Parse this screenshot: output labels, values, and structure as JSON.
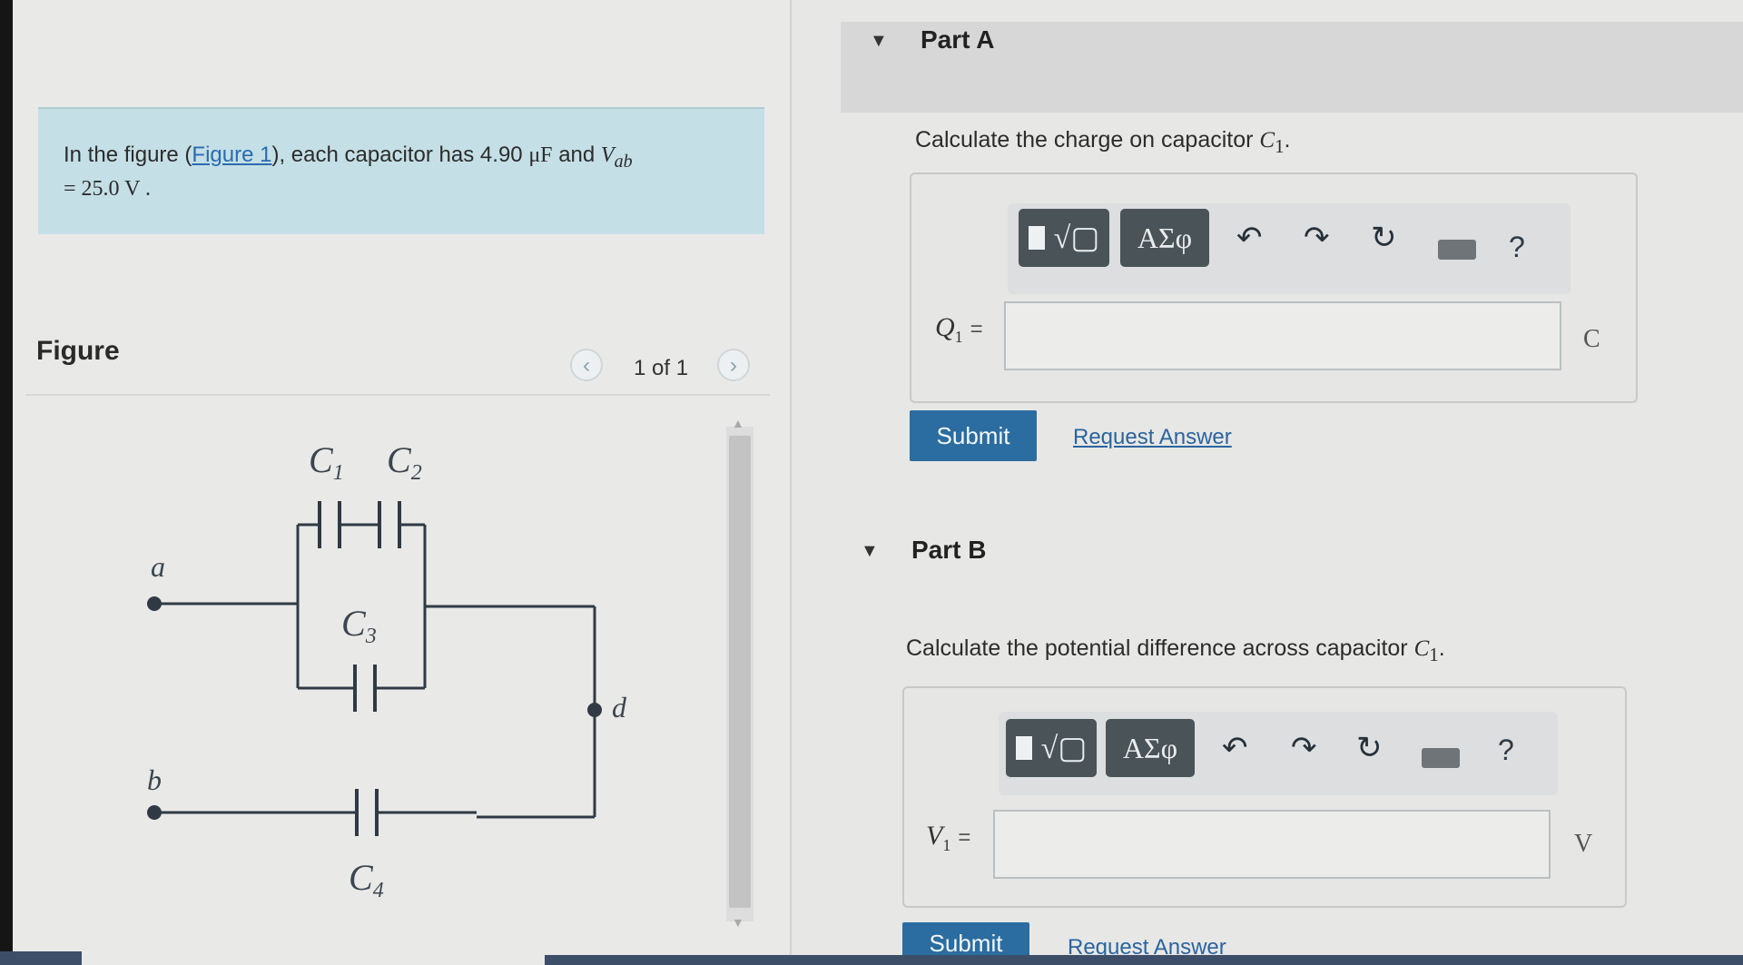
{
  "problem": {
    "text_before_link": "In the figure (",
    "link": "Figure 1",
    "text_after_link": "), each capacitor has 4.90 ",
    "capacitance_unit": "μF",
    "text_and": " and ",
    "voltage_symbol": "V",
    "voltage_sub": "ab",
    "voltage_value_line": "= 25.0 V ."
  },
  "figure": {
    "heading": "Figure",
    "pager": "1 of 1",
    "labels": {
      "c1": "C",
      "c1_sub": "1",
      "c2": "C",
      "c2_sub": "2",
      "c3": "C",
      "c3_sub": "3",
      "c4": "C",
      "c4_sub": "4",
      "a": "a",
      "b": "b",
      "d": "d"
    }
  },
  "partA": {
    "title": "Part A",
    "question_text": "Calculate the charge on capacitor ",
    "question_symbol": "C",
    "question_sub": "1",
    "question_end": ".",
    "greek_button": "ΑΣφ",
    "help": "?",
    "var_symbol": "Q",
    "var_sub": "1",
    "equals": "=",
    "unit": "C",
    "submit": "Submit",
    "request_answer": "Request Answer"
  },
  "partB": {
    "title": "Part B",
    "question_text": "Calculate the potential difference across capacitor ",
    "question_symbol": "C",
    "question_sub": "1",
    "question_end": ".",
    "greek_button": "ΑΣφ",
    "help": "?",
    "var_symbol": "V",
    "var_sub": "1",
    "equals": "=",
    "unit": "V",
    "submit": "Submit",
    "request_answer": "Request Answer"
  },
  "icons": {
    "undo": "undo-icon",
    "redo": "redo-icon",
    "reset": "reset-icon",
    "keyboard": "keyboard-icon",
    "help": "help-icon",
    "caret": "caret-down-icon"
  }
}
